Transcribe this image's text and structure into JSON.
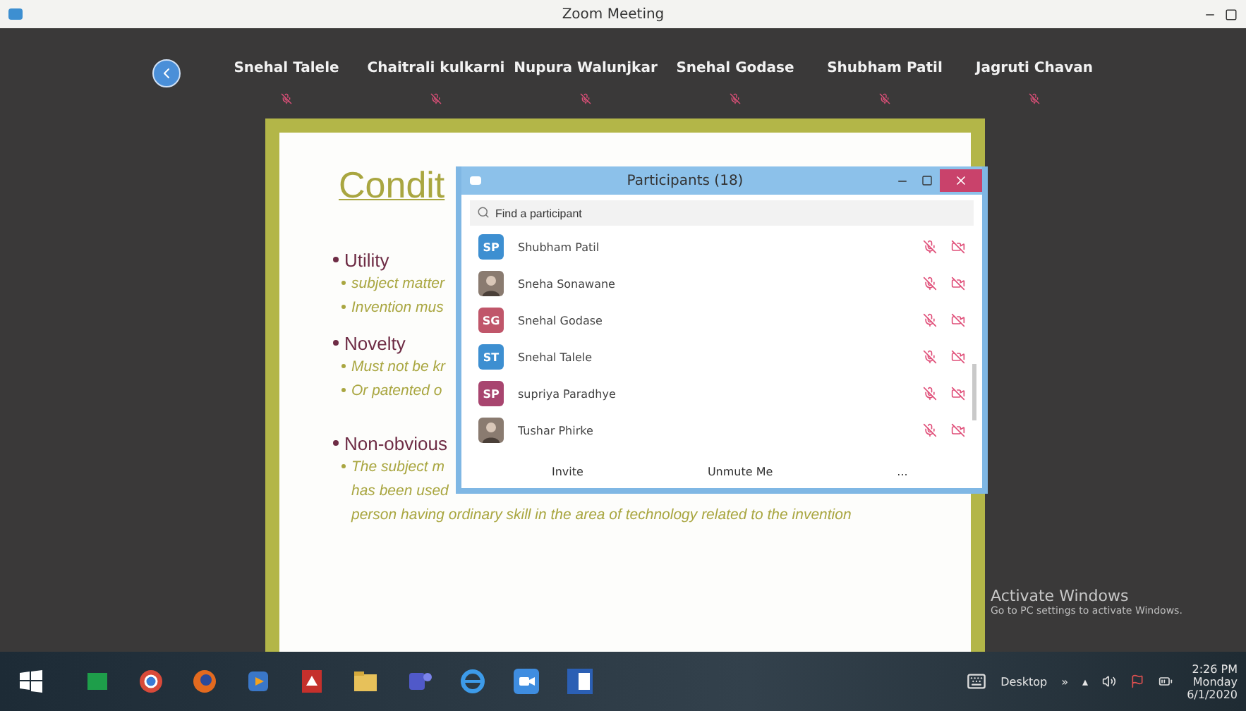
{
  "window": {
    "title": "Zoom Meeting"
  },
  "video_strip": {
    "names": [
      "Snehal Talele",
      "Chaitrali kulkarni",
      "Nupura Walunjkar",
      "Snehal Godase",
      "Shubham Patil",
      "Jagruti Chavan"
    ]
  },
  "slide": {
    "title": "Condit",
    "bullets": [
      {
        "text": "Utility",
        "children": [
          {
            "lines": [
              "subject matter"
            ]
          },
          {
            "lines": [
              "Invention mus"
            ]
          }
        ]
      },
      {
        "text": "Novelty",
        "children": [
          {
            "lines": [
              "Must not be kr"
            ]
          },
          {
            "lines": [
              "Or patented o"
            ]
          }
        ]
      },
      {
        "text": "Non-obvious",
        "children": [
          {
            "lines": [
              "The subject m",
              "has been used",
              "person having ordinary skill in the area of technology related to the invention"
            ]
          }
        ]
      }
    ]
  },
  "participants": {
    "title": "Participants (18)",
    "search": {
      "placeholder": "Find a participant"
    },
    "items": [
      {
        "name": "Shubham Patil",
        "avatar": {
          "kind": "initials",
          "initials": "SP",
          "color": "#3d8fd1"
        }
      },
      {
        "name": "Sneha Sonawane",
        "avatar": {
          "kind": "photo"
        }
      },
      {
        "name": "Snehal Godase",
        "avatar": {
          "kind": "initials",
          "initials": "SG",
          "color": "#c0566a"
        }
      },
      {
        "name": "Snehal Talele",
        "avatar": {
          "kind": "initials",
          "initials": "ST",
          "color": "#3d8fd1"
        }
      },
      {
        "name": "supriya Paradhye",
        "avatar": {
          "kind": "initials",
          "initials": "SP",
          "color": "#a8456f"
        }
      },
      {
        "name": "Tushar Phirke",
        "avatar": {
          "kind": "photo"
        }
      }
    ],
    "buttons": [
      "Invite",
      "Unmute Me",
      "..."
    ]
  },
  "activation": {
    "title": "Activate Windows",
    "note": "Go to PC settings to activate Windows."
  },
  "taskbar": {
    "apps": [
      {
        "kind": "store"
      },
      {
        "kind": "chrome"
      },
      {
        "kind": "firefox"
      },
      {
        "kind": "media"
      },
      {
        "kind": "pdf"
      },
      {
        "kind": "folder"
      },
      {
        "kind": "teams"
      },
      {
        "kind": "ie"
      },
      {
        "kind": "zoom"
      },
      {
        "kind": "word"
      }
    ],
    "desktop_label": "Desktop",
    "overflow": "»",
    "tray_arrow": "▴",
    "time": "2:26 PM",
    "day": "Monday",
    "date": "6/1/2020"
  }
}
